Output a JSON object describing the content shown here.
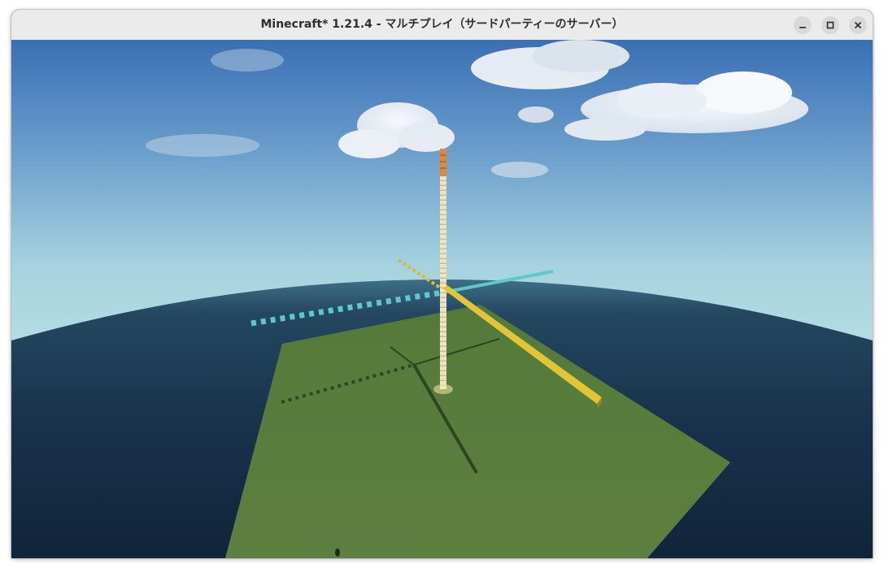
{
  "window": {
    "title": "Minecraft* 1.21.4 - マルチプレイ（サードパーティーのサーバー）",
    "controls": {
      "minimize": "minimize-icon",
      "maximize": "maximize-icon",
      "close": "close-icon"
    }
  },
  "scene": {
    "description_colors": {
      "sky_top": "#3a6fb4",
      "sky_horizon": "#a6d3df",
      "ocean": "#1a3550",
      "grass": "#5b7d3e",
      "y_axis_pillar": "#efe4c0",
      "y_axis_top": "#e0883a",
      "x_axis_bar": "#e2c437",
      "z_axis_bar": "#5fc6cc"
    }
  }
}
